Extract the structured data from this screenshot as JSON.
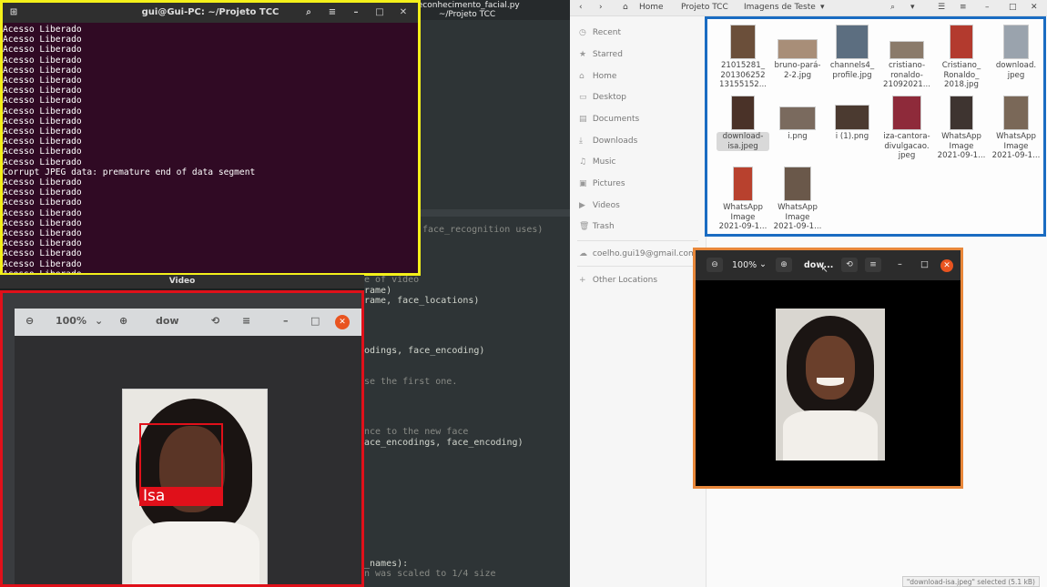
{
  "terminal": {
    "title": "gui@Gui-PC: ~/Projeto TCC",
    "lines_before": [
      "Acesso Liberado",
      "Acesso Liberado",
      "Acesso Liberado",
      "Acesso Liberado",
      "Acesso Liberado",
      "Acesso Liberado",
      "Acesso Liberado",
      "Acesso Liberado",
      "Acesso Liberado",
      "Acesso Liberado",
      "Acesso Liberado",
      "Acesso Liberado",
      "Acesso Liberado",
      "Acesso Liberado"
    ],
    "error_line": "Corrupt JPEG data: premature end of data segment",
    "lines_after": [
      "Acesso Liberado",
      "Acesso Liberado",
      "Acesso Liberado",
      "Acesso Liberado",
      "Acesso Liberado",
      "Acesso Liberado",
      "Acesso Liberado",
      "Acesso Liberado",
      "Acesso Liberado",
      "Acesso Liberado"
    ]
  },
  "video": {
    "title": "Video",
    "zoom": "100%",
    "doc_name": "dow",
    "face_label": "Isa"
  },
  "editor": {
    "window_title": "reconhecimento_facial.py",
    "window_subtitle": "~/Projeto TCC",
    "code": [
      "face_recognition uses)",
      "e of video",
      "rame)",
      "rame, face_locations)",
      "odings, face_encoding)",
      "se the first one.",
      "nce to the new face",
      "ace_encodings, face_encoding)",
      "_names):",
      "n was scaled to 1/4 size"
    ]
  },
  "files": {
    "breadcrumb": [
      "Home",
      "Projeto TCC",
      "Imagens de Teste"
    ],
    "sidebar": [
      "Recent",
      "Starred",
      "Home",
      "Desktop",
      "Documents",
      "Downloads",
      "Music",
      "Pictures",
      "Videos",
      "Trash"
    ],
    "account": "coelho.gui19@gmail.com",
    "other_locations": "Other Locations",
    "items": [
      {
        "name": "21015281_201306252131551 52...",
        "line1": "21015281_",
        "line2": "201306252",
        "line3": "13155152...",
        "color": "#6b4f3a"
      },
      {
        "name": "bruno-pará-2-2.jpg",
        "line1": "bruno-pará-",
        "line2": "2-2.jpg",
        "line3": "",
        "color": "#a88e78"
      },
      {
        "name": "channels4_profile.jpg",
        "line1": "channels4_",
        "line2": "profile.jpg",
        "line3": "",
        "color": "#5c6e80"
      },
      {
        "name": "cristiano-ronaldo-21092021...",
        "line1": "cristiano-",
        "line2": "ronaldo-",
        "line3": "21092021...",
        "color": "#8a7a6a"
      },
      {
        "name": "Cristiano_Ronaldo_2018.jpg",
        "line1": "Cristiano_",
        "line2": "Ronaldo_",
        "line3": "2018.jpg",
        "color": "#b33a2e"
      },
      {
        "name": "download.jpeg",
        "line1": "download.",
        "line2": "jpeg",
        "line3": "",
        "color": "#9aa3ad"
      },
      {
        "name": "download-isa.jpeg",
        "line1": "download-",
        "line2": "isa.jpeg",
        "line3": "",
        "color": "#4a3228"
      },
      {
        "name": "i.png",
        "line1": "i.png",
        "line2": "",
        "line3": "",
        "color": "#7a6a5e"
      },
      {
        "name": "i (1).png",
        "line1": "i (1).png",
        "line2": "",
        "line3": "",
        "color": "#4b3a30"
      },
      {
        "name": "iza-cantora-divulgacao.jpeg",
        "line1": "iza-cantora-",
        "line2": "divulgacao.",
        "line3": "jpeg",
        "color": "#8e2a3a"
      },
      {
        "name": "WhatsApp Image 2021-09-1...",
        "line1": "WhatsApp",
        "line2": "Image",
        "line3": "2021-09-1...",
        "color": "#3e3430"
      },
      {
        "name": "WhatsApp Image 2021-09-1...",
        "line1": "WhatsApp",
        "line2": "Image",
        "line3": "2021-09-1...",
        "color": "#7a6858"
      },
      {
        "name": "WhatsApp Image 2021-09-1...",
        "line1": "WhatsApp",
        "line2": "Image",
        "line3": "2021-09-1...",
        "color": "#b8412e"
      },
      {
        "name": "WhatsApp Image 2021-09-1...",
        "line1": "WhatsApp",
        "line2": "Image",
        "line3": "2021-09-1...",
        "color": "#6a584a"
      }
    ],
    "status": "\"download-isa.jpeg\" selected (5.1 kB)"
  },
  "viewer": {
    "zoom": "100%",
    "title": "dow..."
  }
}
